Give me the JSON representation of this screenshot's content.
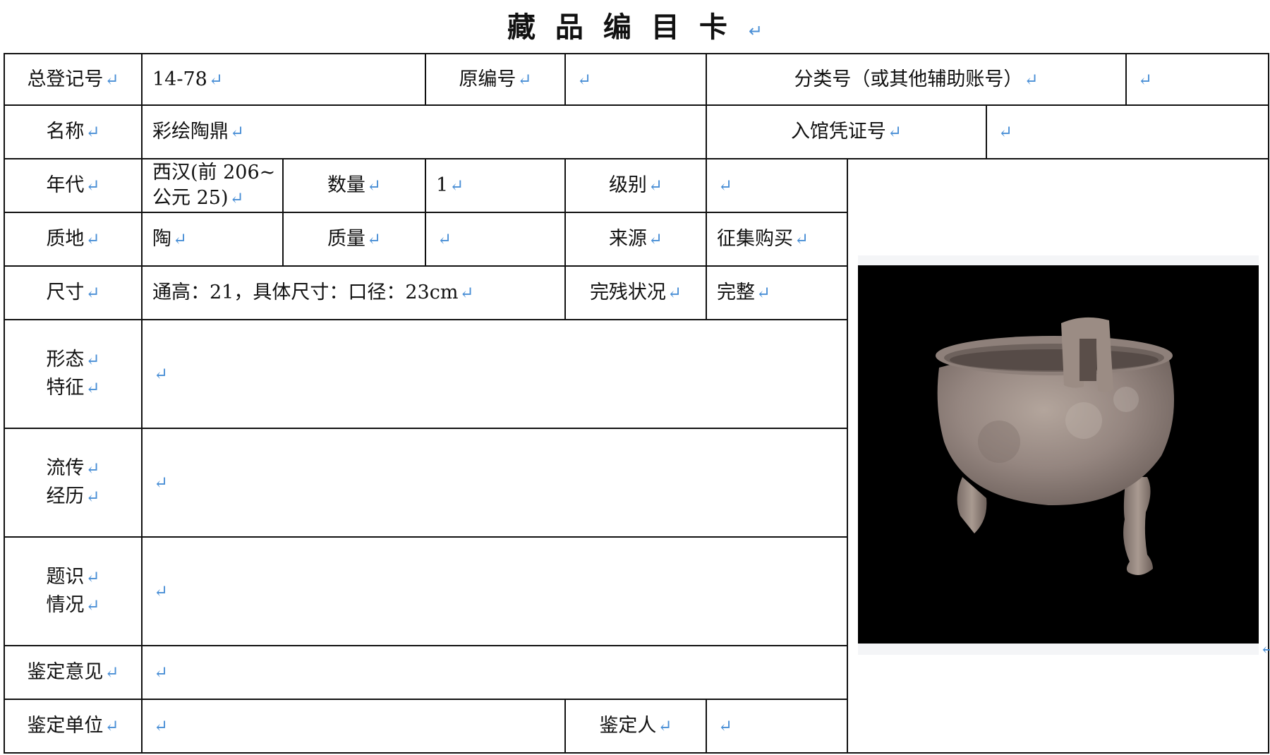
{
  "title": "藏品编目卡",
  "return_mark": "↵",
  "fields": {
    "reg_no_label": "总登记号",
    "reg_no_value": "14-78",
    "orig_no_label": "原编号",
    "orig_no_value": "",
    "class_no_label": "分类号（或其他辅助账号）",
    "class_no_value": "",
    "name_label": "名称",
    "name_value": "彩绘陶鼎",
    "voucher_label": "入馆凭证号",
    "voucher_value": "",
    "era_label": "年代",
    "era_value_line1": "西汉(前 206~",
    "era_value_line2": "公元 25)",
    "quantity_label": "数量",
    "quantity_value": "1",
    "grade_label": "级别",
    "grade_value": "",
    "material_label": "质地",
    "material_value": "陶",
    "mass_label": "质量",
    "mass_value": "",
    "source_label": "来源",
    "source_value": "征集购买",
    "size_label": "尺寸",
    "size_value": "通高：21，具体尺寸：口径：23cm",
    "condition_label": "完残状况",
    "condition_value": "完整",
    "form_label_1": "形态",
    "form_label_2": "特征",
    "form_value": "",
    "history_label_1": "流传",
    "history_label_2": "经历",
    "history_value": "",
    "inscription_label_1": "题识",
    "inscription_label_2": "情况",
    "inscription_value": "",
    "opinion_label": "鉴定意见",
    "opinion_value": "",
    "unit_label": "鉴定单位",
    "unit_value": "",
    "appraiser_label": "鉴定人",
    "appraiser_value": ""
  },
  "photo": {
    "subject": "three-legged ceramic ding vessel on black background"
  }
}
